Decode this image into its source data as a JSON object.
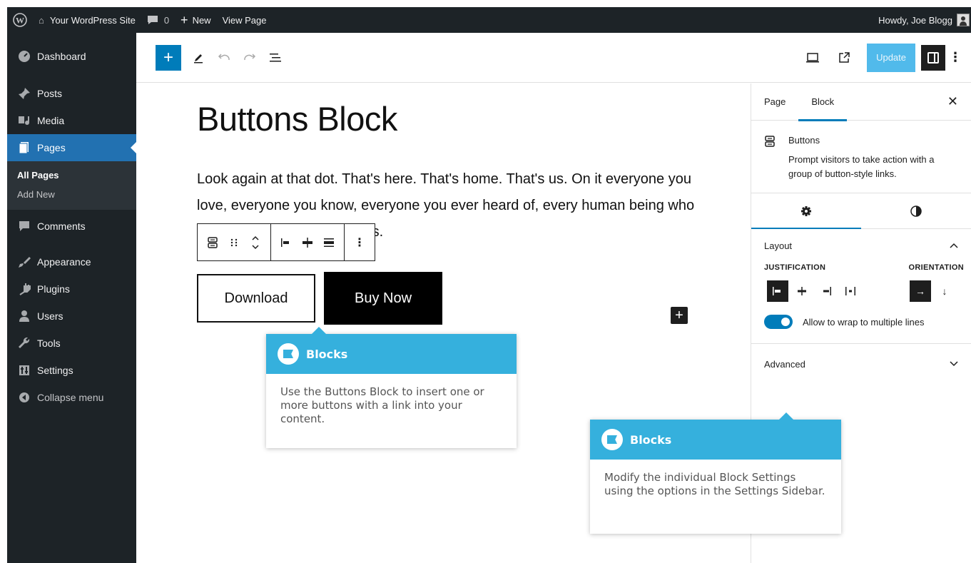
{
  "adminbar": {
    "site_name": "Your WordPress Site",
    "comments_count": "0",
    "new_label": "New",
    "view_page": "View Page",
    "howdy": "Howdy, Joe Blogg"
  },
  "sidebar": {
    "items": [
      {
        "label": "Dashboard",
        "icon": "dashboard-icon"
      },
      {
        "label": "Posts",
        "icon": "pin-icon"
      },
      {
        "label": "Media",
        "icon": "media-icon"
      },
      {
        "label": "Pages",
        "icon": "pages-icon"
      },
      {
        "label": "Comments",
        "icon": "comment-icon"
      },
      {
        "label": "Appearance",
        "icon": "brush-icon"
      },
      {
        "label": "Plugins",
        "icon": "plug-icon"
      },
      {
        "label": "Users",
        "icon": "user-icon"
      },
      {
        "label": "Tools",
        "icon": "wrench-icon"
      },
      {
        "label": "Settings",
        "icon": "settings-icon"
      },
      {
        "label": "Collapse menu",
        "icon": "collapse-icon"
      }
    ],
    "submenu": [
      "All Pages",
      "Add New"
    ]
  },
  "header": {
    "update_label": "Update"
  },
  "canvas": {
    "title": "Buttons Block",
    "paragraph": "Look again at that dot. That's here. That's home. That's us. On it everyone you love, everyone you know, everyone you ever heard of, every human being who ever was, lived out their lives.",
    "paragraph_visible_tail": "is, lived out their lives.",
    "button_download": "Download",
    "button_buy": "Buy Now"
  },
  "settings_sidebar": {
    "tab_page": "Page",
    "tab_block": "Block",
    "block_name": "Buttons",
    "block_desc": "Prompt visitors to take action with a group of button-style links.",
    "layout_title": "Layout",
    "justification_label": "JUSTIFICATION",
    "orientation_label": "ORIENTATION",
    "wrap_label": "Allow to wrap to multiple lines",
    "wrap_enabled": true,
    "advanced_title": "Advanced"
  },
  "callouts": [
    {
      "title": "Blocks",
      "body": "Use the Buttons Block to insert one or more buttons with a link into your content."
    },
    {
      "title": "Blocks",
      "body": "Modify the individual Block Settings using the options in the Settings Sidebar."
    }
  ],
  "colors": {
    "admin_dark": "#1d2327",
    "accent": "#007cba",
    "callout": "#35b0dd"
  }
}
